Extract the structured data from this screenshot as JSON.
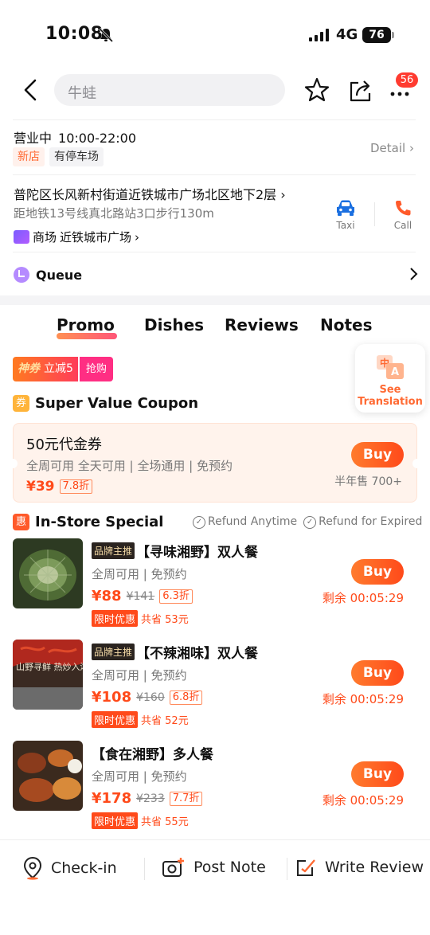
{
  "status": {
    "time": "10:08",
    "network": "4G",
    "battery": "76"
  },
  "header": {
    "search_text": "牛蛙",
    "notification_count": "56"
  },
  "info": {
    "status_label": "营业中",
    "hours": "10:00-22:00",
    "tags": [
      "新店",
      "有停车场"
    ],
    "detail_label": "Detail",
    "address": "普陀区长风新村街道近铁城市广场北区地下2层",
    "subway": "距地铁13号线真北路站3口步行130m",
    "mall_label": "商场",
    "mall_name": "近铁城市广场",
    "taxi_label": "Taxi",
    "call_label": "Call",
    "queue_label": "Queue"
  },
  "tabs": [
    "Promo",
    "Dishes",
    "Reviews",
    "Notes"
  ],
  "promo_badge": {
    "brand": "神券",
    "text": "立减5",
    "action": "抢购"
  },
  "translate": {
    "line1": "See",
    "line2": "Translation"
  },
  "super_coupon": {
    "icon": "券",
    "title": "Super Value Coupon",
    "name": "50元代金券",
    "availability": "全周可用 全天可用 | 全场通用 | 免预约",
    "price": "¥39",
    "discount": "7.8折",
    "sold": "半年售 700+",
    "buy_label": "Buy"
  },
  "instore": {
    "icon": "惠",
    "title": "In-Store Special",
    "policies": [
      "Refund Anytime",
      "Refund for Expired"
    ]
  },
  "deals": [
    {
      "brand_tag": "品牌主推",
      "title": "【寻味湘野】双人餐",
      "availability": "全周可用 | 免预约",
      "price": "¥88",
      "old_price": "¥141",
      "discount": "6.3折",
      "limit": "限时优惠",
      "saved": "共省 53元",
      "remaining": "剩余 00:05:29",
      "buy_label": "Buy"
    },
    {
      "brand_tag": "品牌主推",
      "title": "【不辣湘味】双人餐",
      "availability": "全周可用 | 免预约",
      "price": "¥108",
      "old_price": "¥160",
      "discount": "6.8折",
      "limit": "限时优惠",
      "saved": "共省 52元",
      "remaining": "剩余 00:05:29",
      "buy_label": "Buy",
      "image_text": "山野寻鲜 热炒入湘"
    },
    {
      "brand_tag": "",
      "title": "【食在湘野】多人餐",
      "availability": "全周可用 | 免预约",
      "price": "¥178",
      "old_price": "¥233",
      "discount": "7.7折",
      "limit": "限时优惠",
      "saved": "共省 55元",
      "remaining": "剩余 00:05:29",
      "buy_label": "Buy"
    }
  ],
  "bottom_bar": {
    "checkin": "Check-in",
    "post_note": "Post Note",
    "write_review": "Write Review"
  },
  "colors": {
    "accent": "#ff4a1a",
    "accent_light": "#fff3ec"
  }
}
